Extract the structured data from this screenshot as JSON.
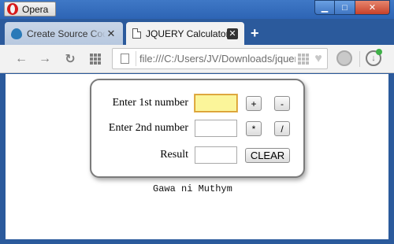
{
  "window": {
    "app_button_label": "Opera",
    "controls": {
      "minimize": "▁",
      "maximize": "□",
      "close": "✕"
    }
  },
  "tabs": [
    {
      "title": "Create Source Code",
      "icon": "drupal-icon",
      "active": false,
      "close": "✕"
    },
    {
      "title": "JQUERY Calculator",
      "icon": "page-icon",
      "active": true,
      "close": "✕"
    }
  ],
  "new_tab_label": "+",
  "toolbar": {
    "back_icon": "←",
    "forward_icon": "→",
    "reload_icon": "↻",
    "address": "file:///C:/Users/JV/Downloads/jquery",
    "heart_icon": "♥"
  },
  "calculator": {
    "first_label": "Enter 1st number",
    "second_label": "Enter 2nd number",
    "result_label": "Result",
    "first_value": "",
    "second_value": "",
    "result_value": "",
    "buttons": {
      "add": "+",
      "subtract": "-",
      "multiply": "*",
      "divide": "/",
      "clear": "CLEAR"
    }
  },
  "footer_text": "Gawa ni Muthym",
  "colors": {
    "titlebar": "#2d64b4",
    "focused_input": "#fbf59a",
    "close_button": "#c7412a"
  }
}
